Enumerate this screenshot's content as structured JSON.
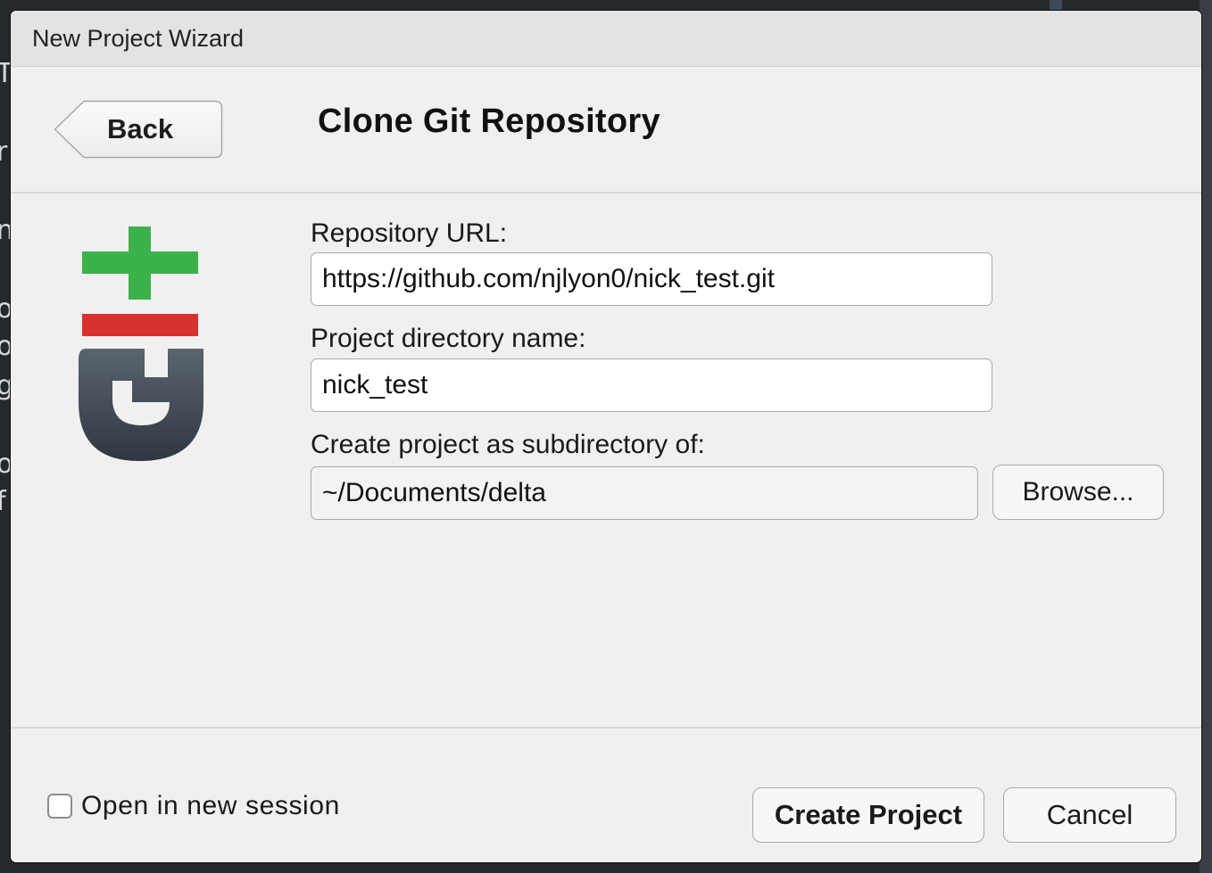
{
  "background_fragments": [
    "T",
    "r",
    "n",
    "o",
    "o",
    "g",
    "o",
    "f"
  ],
  "dialog": {
    "window_title": "New Project Wizard",
    "back_label": "Back",
    "page_title": "Clone Git Repository"
  },
  "form": {
    "repo_url_label": "Repository URL:",
    "repo_url_value": "https://github.com/njlyon0/nick_test.git",
    "dir_name_label": "Project directory name:",
    "dir_name_value": "nick_test",
    "subdir_label": "Create project as subdirectory of:",
    "subdir_value": "~/Documents/delta",
    "browse_label": "Browse..."
  },
  "footer": {
    "open_new_session_label": "Open in new session",
    "open_new_session_checked": false,
    "create_label": "Create Project",
    "cancel_label": "Cancel"
  },
  "icons": {
    "logo": "git-logo-icon",
    "back_arrow": "back-arrow-icon"
  },
  "colors": {
    "git_plus_green": "#3cb34a",
    "git_minus_red": "#d6332f",
    "git_g_dark": "#3f4954",
    "dialog_bg": "#f0f0f0"
  }
}
